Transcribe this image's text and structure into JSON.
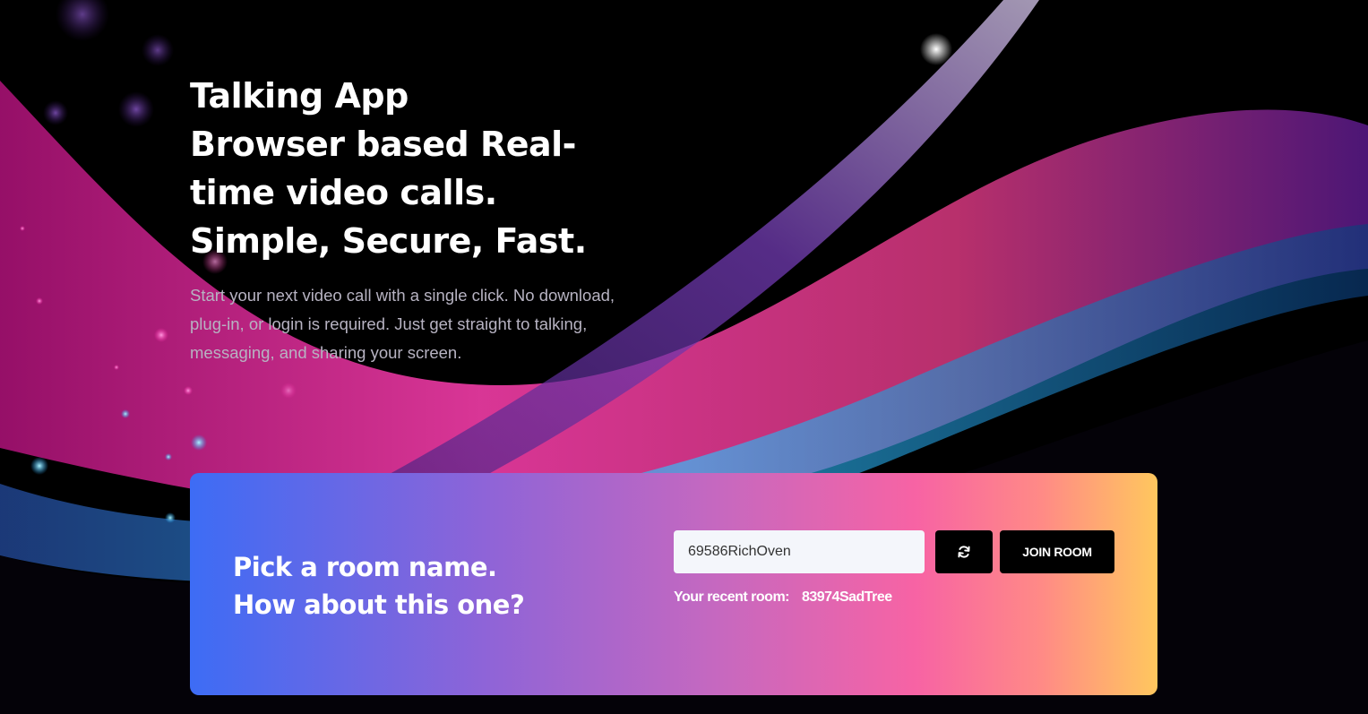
{
  "hero": {
    "title_lines": [
      "Talking App",
      "Browser based Real-",
      "time video calls.",
      "Simple, Secure, Fast."
    ],
    "subtitle": "Start your next video call with a single click. No download, plug-in, or login is required. Just get straight to talking, messaging, and sharing your screen."
  },
  "room_card": {
    "heading_lines": [
      "Pick a room name.",
      "How about this one?"
    ],
    "room_input_value": "69586RichOven",
    "refresh_icon": "refresh-icon",
    "join_label": "JOIN ROOM",
    "recent_label": "Your recent room:",
    "recent_room": "83974SadTree"
  },
  "colors": {
    "background": "#000000",
    "card_gradient": [
      "#3d6cf5",
      "#8d64d8",
      "#c768bf",
      "#f763a4",
      "#ff8a86",
      "#ffc75e"
    ],
    "wave_pink": "#e0308f",
    "wave_blue": "#27b6ea",
    "button": "#000000",
    "input_bg": "#f4f6fb"
  }
}
